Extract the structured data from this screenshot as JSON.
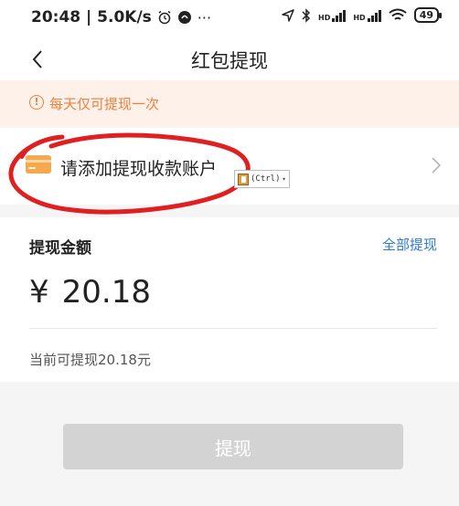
{
  "status_bar": {
    "time_network": "20:48 | 5.0K/s",
    "alarm_icon": "alarm-clock-icon",
    "more": "···",
    "hd1": "HD",
    "hd2": "HD",
    "battery": "49"
  },
  "header": {
    "title": "红包提现",
    "back_icon": "chevron-left-icon"
  },
  "notice": {
    "icon": "!",
    "text": "每天仅可提现一次",
    "color": "#f0803c"
  },
  "account": {
    "text": "请添加提现收款账户",
    "icon": "bank-card-icon",
    "chevron": "chevron-right-icon"
  },
  "paste_tip": {
    "label": "(Ctrl)",
    "caret": "▾"
  },
  "amount": {
    "label": "提现金额",
    "withdraw_all": "全部提现",
    "currency": "¥",
    "value": "20.18",
    "available": "当前可提现20.18元"
  },
  "submit": {
    "label": "提现"
  },
  "colors": {
    "accent_link": "#2f7bd9",
    "disabled_button": "#d3d3d3",
    "annotation_red": "#e02020"
  }
}
